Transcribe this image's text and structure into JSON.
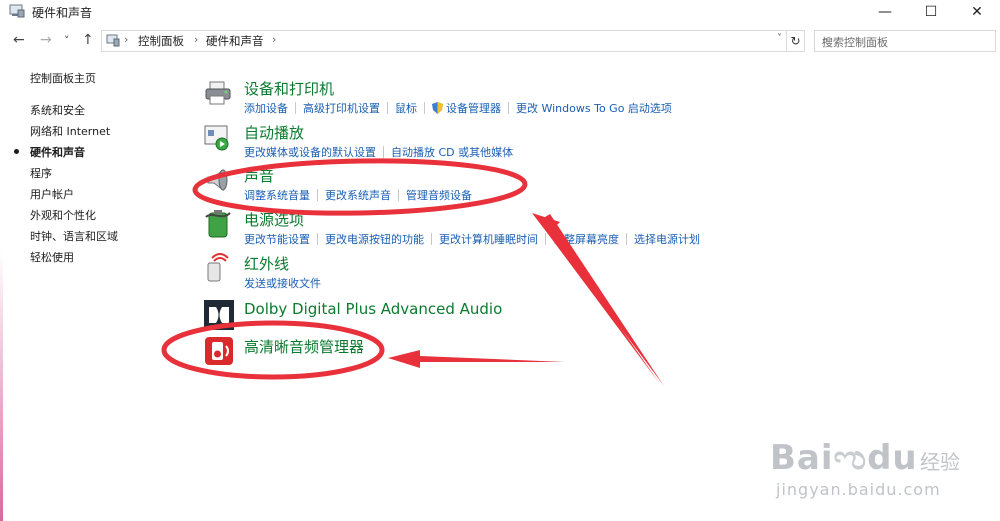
{
  "window": {
    "title": "硬件和声音",
    "minimize": "—",
    "maximize": "☐",
    "close": "✕"
  },
  "nav": {
    "back": "←",
    "forward": "→",
    "dropdown": "˅",
    "up": "↑"
  },
  "address": {
    "crumbs": [
      "控制面板",
      "硬件和声音"
    ],
    "separator": "›",
    "dropdown": "˅",
    "refresh": "↻"
  },
  "search": {
    "placeholder": "搜索控制面板",
    "icon": "⌕"
  },
  "sidebar": {
    "home": "控制面板主页",
    "items": [
      "系统和安全",
      "网络和 Internet",
      "硬件和声音",
      "程序",
      "用户帐户",
      "外观和个性化",
      "时钟、语言和区域",
      "轻松使用"
    ],
    "active_index": 2
  },
  "categories": [
    {
      "title": "设备和打印机",
      "icon": "printer-icon",
      "links": [
        "添加设备",
        "高级打印机设置",
        "鼠标",
        "设备管理器",
        "更改 Windows To Go 启动选项"
      ]
    },
    {
      "title": "自动播放",
      "icon": "autoplay-icon",
      "links": [
        "更改媒体或设备的默认设置",
        "自动播放 CD 或其他媒体"
      ]
    },
    {
      "title": "声音",
      "icon": "speaker-icon",
      "links": [
        "调整系统音量",
        "更改系统声音",
        "管理音频设备"
      ]
    },
    {
      "title": "电源选项",
      "icon": "battery-icon",
      "links": [
        "更改节能设置",
        "更改电源按钮的功能",
        "更改计算机睡眠时间",
        "调整屏幕亮度",
        "选择电源计划"
      ]
    },
    {
      "title": "红外线",
      "icon": "infrared-icon",
      "links": [
        "发送或接收文件"
      ]
    },
    {
      "title": "Dolby Digital Plus Advanced Audio",
      "icon": "dolby-icon",
      "links": []
    },
    {
      "title": "高清晰音频管理器",
      "icon": "hd-audio-icon",
      "links": []
    }
  ],
  "watermark": {
    "brand": "Bai",
    "brand2": "du",
    "sub": "经验",
    "url": "jingyan.baidu.com"
  },
  "colors": {
    "link": "#1a5fb4",
    "category_title": "#0a7b2e",
    "annotation": "#e8313a"
  }
}
